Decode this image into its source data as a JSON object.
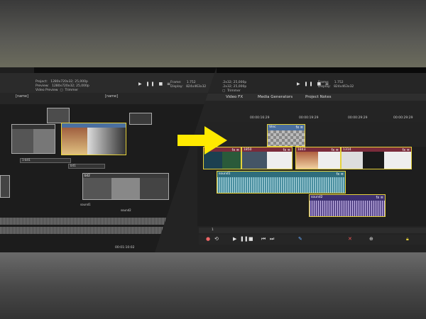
{
  "left_panel": {
    "info_lines": "Project:   1280x720x32; 25,000p\nPreview:   1280x720x32; 25,000p\nVideo Preview  ▢  Trimmer",
    "frame_text": "Frame:     1.752\nDisplay:   824x463x32",
    "transport": "▶ ❚❚ ■ ≡",
    "markers": [
      "[name]",
      "[name]"
    ],
    "track_labels": [
      "1-bit1",
      "bit1",
      "bit2",
      "sound1",
      "sound2"
    ],
    "status_time": "00:01:10:02"
  },
  "right_panel": {
    "info_lines": ".2x32; 25,000p\n.2x32; 25,000p\n▢  Trimmer",
    "frame_text": "Frame:     1.752\nDisplay:   824x463x32",
    "transport": "▶ ❚❚ ■ ≡",
    "tabs": [
      "Video FX",
      "Media Generators",
      "Project Notes"
    ],
    "ruler_times": [
      "00:00:16:29",
      "00:00:19:29",
      "00:00:29:29",
      "00:00:29:29"
    ],
    "clips": {
      "top": "Vinc",
      "v1": "1",
      "v2": "1850",
      "v3": "1843",
      "v4": "1314",
      "sound1": "sound1",
      "sound2": "sound2"
    },
    "bottom_bar_num": "1"
  },
  "colors": {
    "accent_yellow": "#ffea00",
    "clip_border": "#e6d23a",
    "video_header": "#7a2b3a",
    "audio1": "#4a8fa0",
    "audio2": "#5a4a8c"
  },
  "icons": [
    "arrow-right-icon",
    "play-icon",
    "pause-icon",
    "stop-icon",
    "fx-icon",
    "loop-icon",
    "record-icon"
  ]
}
